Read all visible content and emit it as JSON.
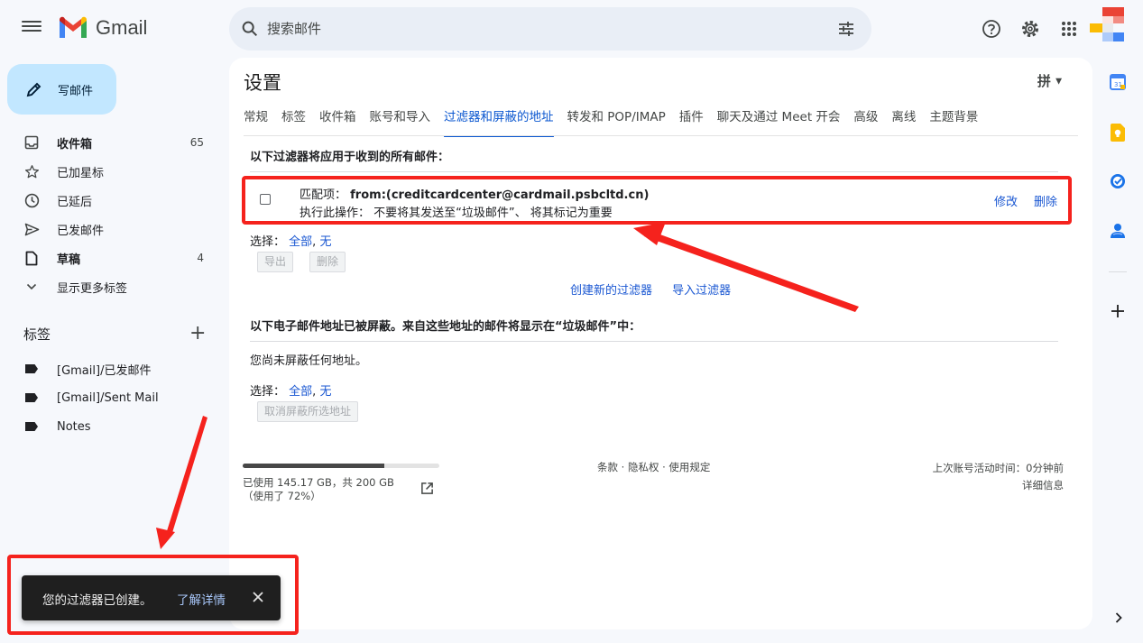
{
  "header": {
    "app_name": "Gmail",
    "search_placeholder": "搜索邮件"
  },
  "sidebar": {
    "compose_label": "写邮件",
    "items": [
      {
        "label": "收件箱",
        "count": "65",
        "bold": true
      },
      {
        "label": "已加星标",
        "count": ""
      },
      {
        "label": "已延后",
        "count": ""
      },
      {
        "label": "已发邮件",
        "count": ""
      },
      {
        "label": "草稿",
        "count": "4",
        "bold": true
      },
      {
        "label": "显示更多标签",
        "count": ""
      }
    ],
    "labels_heading": "标签",
    "labels_add": "+",
    "labels": [
      "[Gmail]/已发邮件",
      "[Gmail]/Sent Mail",
      "Notes"
    ]
  },
  "settings": {
    "title": "设置",
    "input_tool": "拼",
    "tabs": [
      "常规",
      "标签",
      "收件箱",
      "账号和导入",
      "过滤器和屏蔽的地址",
      "转发和 POP/IMAP",
      "插件",
      "聊天及通过 Meet 开会",
      "高级",
      "离线",
      "主题背景"
    ],
    "active_tab": "过滤器和屏蔽的地址",
    "filters_heading": "以下过滤器将应用于收到的所有邮件：",
    "filter": {
      "match_label": "匹配项：",
      "match_value": "from:(creditcardcenter@cardmail.psbcltd.cn)",
      "action_label": "执行此操作：",
      "action_value": "不要将其发送至“垃圾邮件”、 将其标记为重要",
      "edit": "修改",
      "delete": "删除"
    },
    "select_label": "选择：",
    "select_all": "全部",
    "select_none": "无",
    "export_btn": "导出",
    "delete_btn": "删除",
    "create_filter": "创建新的过滤器",
    "import_filter": "导入过滤器",
    "blocked_heading": "以下电子邮件地址已被屏蔽。来自这些地址的邮件将显示在“垃圾邮件”中：",
    "no_blocked": "您尚未屏蔽任何地址。",
    "unblock_btn": "取消屏蔽所选地址"
  },
  "footer": {
    "storage_text": "已使用 145.17 GB，共 200 GB（使用了 72%）",
    "storage_percent": 72,
    "links": "条款 · 隐私权 · 使用规定",
    "last_activity": "上次账号活动时间：0分钟前",
    "details": "详细信息"
  },
  "snackbar": {
    "message": "您的过滤器已创建。",
    "link": "了解详情"
  },
  "colors": {
    "accent": "#0b57d0",
    "compose_bg": "#c2e7ff",
    "annotation_red": "#f5221d"
  }
}
